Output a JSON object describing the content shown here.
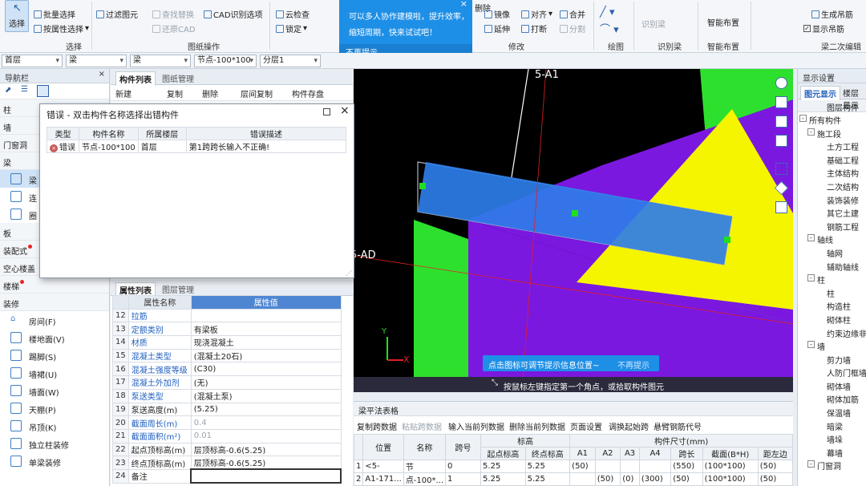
{
  "ribbon": {
    "select_label": "选择",
    "items_col1": [
      "批量选择",
      "按属性选择"
    ],
    "items_col2": [
      "过滤图元",
      "还原CAD"
    ],
    "items_col3": [
      "查找替换",
      "CAD识别选项"
    ],
    "items_col4": [
      "云检查",
      "锁定"
    ],
    "items_col5": [
      "删除",
      "镜像",
      "延伸"
    ],
    "items_col6": [
      "对齐",
      "打断"
    ],
    "items_col7": [
      "合并",
      "分割"
    ],
    "identify_beam": "识别梁",
    "smart_layout": "智能布置",
    "items_right": [
      "生成吊筋",
      "显示吊筋"
    ],
    "groups": [
      "选择",
      "图纸操作",
      "修改",
      "绘图",
      "识别梁",
      "智能布置",
      "梁二次编辑"
    ]
  },
  "popup": {
    "message": "可以多人协作建模啦，提升效率，缩短周期，快来试试吧！",
    "dismiss": "不再提示"
  },
  "bar2": {
    "floor": "首层",
    "type1": "梁",
    "type2": "梁",
    "node": "节点-100*100",
    "layer": "分层1"
  },
  "nav": {
    "title": "导航栏",
    "categories": [
      {
        "label": "柱",
        "dot": false
      },
      {
        "label": "墙",
        "dot": false
      },
      {
        "label": "门窗洞",
        "dot": false
      },
      {
        "label": "梁",
        "dot": false
      }
    ],
    "beam_subs": [
      "梁",
      "连",
      "圈"
    ],
    "categories2": [
      {
        "label": "板",
        "dot": false
      },
      {
        "label": "装配式",
        "dot": true
      },
      {
        "label": "空心楼盖",
        "dot": false
      },
      {
        "label": "楼梯",
        "dot": true
      },
      {
        "label": "装修",
        "dot": false
      }
    ],
    "deco_items": [
      "房间(F)",
      "楼地面(V)",
      "踢脚(S)",
      "墙裙(U)",
      "墙面(W)",
      "天棚(P)",
      "吊顶(K)",
      "独立柱装修",
      "单梁装修"
    ]
  },
  "mid": {
    "tabs_top": [
      "构件列表",
      "图纸管理"
    ],
    "toolbar": [
      "新建",
      "复制",
      "删除",
      "层间复制",
      "构件存盘"
    ],
    "tabs_bottom": [
      "属性列表",
      "图层管理"
    ]
  },
  "props": {
    "header": [
      "属性名称",
      "属性值"
    ],
    "rows": [
      {
        "n": "12",
        "k": "拉筋",
        "v": "",
        "black": false,
        "gray": false
      },
      {
        "n": "13",
        "k": "定额类别",
        "v": "有梁板",
        "black": false,
        "gray": false
      },
      {
        "n": "14",
        "k": "材质",
        "v": "现浇混凝土",
        "black": false,
        "gray": false
      },
      {
        "n": "15",
        "k": "混凝土类型",
        "v": "(混凝土20石)",
        "black": false,
        "gray": false
      },
      {
        "n": "16",
        "k": "混凝土强度等级",
        "v": "(C30)",
        "black": false,
        "gray": false
      },
      {
        "n": "17",
        "k": "混凝土外加剂",
        "v": "(无)",
        "black": false,
        "gray": false
      },
      {
        "n": "18",
        "k": "泵送类型",
        "v": "(混凝土泵)",
        "black": false,
        "gray": false
      },
      {
        "n": "19",
        "k": "泵送高度(m)",
        "v": "(5.25)",
        "black": true,
        "gray": false
      },
      {
        "n": "20",
        "k": "截面周长(m)",
        "v": "0.4",
        "black": false,
        "gray": true
      },
      {
        "n": "21",
        "k": "截面面积(m²)",
        "v": "0.01",
        "black": false,
        "gray": true
      },
      {
        "n": "22",
        "k": "起点顶标高(m)",
        "v": "层顶标高-0.6(5.25)",
        "black": true,
        "gray": false
      },
      {
        "n": "23",
        "k": "终点顶标高(m)",
        "v": "层顶标高-0.6(5.25)",
        "black": true,
        "gray": false
      },
      {
        "n": "24",
        "k": "备注",
        "v": "",
        "black": true,
        "gray": false
      }
    ]
  },
  "dialog": {
    "title": "错误 - 双击构件名称选择出错构件",
    "headers": [
      "类型",
      "构件名称",
      "所属楼层",
      "错误描述"
    ],
    "row": {
      "type": "错误",
      "name": "节点-100*100",
      "floor": "首层",
      "desc": "第1跨跨长输入不正确!"
    }
  },
  "viewport": {
    "axis_top": "5-A1",
    "axis_left": "5-AD",
    "hint": "点击图标可调节提示信息位置~",
    "hint_dismiss": "不再提示",
    "status": "按鼠标左键指定第一个角点，或拾取构件图元",
    "axis_x": "X",
    "axis_y": "Y"
  },
  "right": {
    "title": "显示设置",
    "tabs": [
      "图元显示",
      "楼层显示"
    ],
    "col_header": "图层构件",
    "tree": [
      {
        "label": "所有构件",
        "level": 0,
        "box": "-"
      },
      {
        "label": "施工段",
        "level": 1,
        "box": "-"
      },
      {
        "label": "土方工程",
        "level": 2,
        "box": ""
      },
      {
        "label": "基础工程",
        "level": 2,
        "box": ""
      },
      {
        "label": "主体结构",
        "level": 2,
        "box": ""
      },
      {
        "label": "二次结构",
        "level": 2,
        "box": ""
      },
      {
        "label": "装饰装修",
        "level": 2,
        "box": ""
      },
      {
        "label": "其它土建",
        "level": 2,
        "box": ""
      },
      {
        "label": "钢筋工程",
        "level": 2,
        "box": ""
      },
      {
        "label": "轴线",
        "level": 1,
        "box": "-"
      },
      {
        "label": "轴网",
        "level": 2,
        "box": ""
      },
      {
        "label": "辅助轴线",
        "level": 2,
        "box": ""
      },
      {
        "label": "柱",
        "level": 1,
        "box": "-"
      },
      {
        "label": "柱",
        "level": 2,
        "box": ""
      },
      {
        "label": "构造柱",
        "level": 2,
        "box": ""
      },
      {
        "label": "砌体柱",
        "level": 2,
        "box": ""
      },
      {
        "label": "约束边缘非阴",
        "level": 2,
        "box": ""
      },
      {
        "label": "墙",
        "level": 1,
        "box": "-"
      },
      {
        "label": "剪力墙",
        "level": 2,
        "box": ""
      },
      {
        "label": "人防门框墙",
        "level": 2,
        "box": ""
      },
      {
        "label": "砌体墙",
        "level": 2,
        "box": ""
      },
      {
        "label": "砌体加筋",
        "level": 2,
        "box": ""
      },
      {
        "label": "保温墙",
        "level": 2,
        "box": ""
      },
      {
        "label": "暗梁",
        "level": 2,
        "box": ""
      },
      {
        "label": "墙垛",
        "level": 2,
        "box": ""
      },
      {
        "label": "幕墙",
        "level": 2,
        "box": ""
      },
      {
        "label": "门窗洞",
        "level": 1,
        "box": "-"
      }
    ]
  },
  "bottom": {
    "title": "梁平法表格",
    "toolbar": [
      {
        "label": "复制跨数据",
        "disabled": false
      },
      {
        "label": "粘贴跨数据",
        "disabled": true
      },
      {
        "label": "输入当前列数据",
        "disabled": false
      },
      {
        "label": "删除当前列数据",
        "disabled": false
      },
      {
        "label": "页面设置",
        "disabled": false
      },
      {
        "label": "调换起始跨",
        "disabled": false
      },
      {
        "label": "悬臂钢筋代号",
        "disabled": false
      }
    ],
    "h_pos": "位置",
    "h_name": "名称",
    "h_span": "跨号",
    "h_elev": "标高",
    "h_size": "构件尺寸(mm)",
    "sub_headers": [
      "起点标高",
      "终点标高",
      "A1",
      "A2",
      "A3",
      "A4",
      "跨长",
      "截面(B*H)",
      "距左边"
    ],
    "rows": [
      {
        "idx": "1",
        "pos": "<5-",
        "name": "节",
        "span": "0",
        "c": [
          "5.25",
          "5.25",
          "(50)",
          "",
          "",
          "",
          "(550)",
          "(100*100)",
          "(50)"
        ]
      },
      {
        "idx": "2",
        "pos": "A1-171...",
        "name": "点-100*...",
        "span": "1",
        "c": [
          "5.25",
          "5.25",
          "",
          "(50)",
          "(0)",
          "(300)",
          "(50)",
          "(100*100)",
          "(50)"
        ]
      }
    ]
  },
  "colors": {
    "accent": "#1e8fe6",
    "header_blue": "#4f86d3",
    "beam_blue": "#2e7de8",
    "purple": "#7a18e0",
    "yellow": "#f5f500",
    "green": "#2ee02e"
  }
}
